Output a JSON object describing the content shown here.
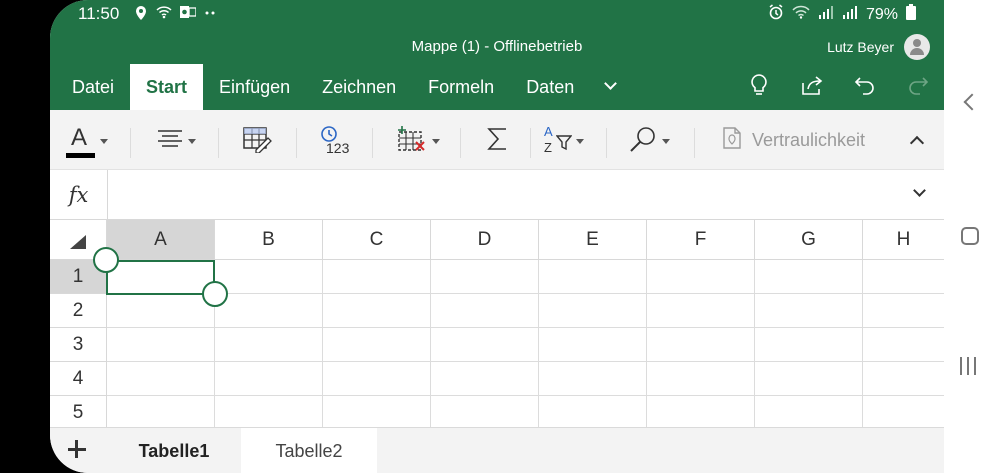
{
  "status": {
    "time": "11:50",
    "battery": "79%",
    "left_icons": [
      "location-icon",
      "wifi-icon",
      "outlook-icon",
      "more-dots-icon"
    ],
    "right_icons": [
      "alarm-icon",
      "wifi-icon",
      "signal-icon",
      "signal-icon",
      "battery-icon"
    ]
  },
  "window": {
    "title": "Mappe (1) - Offlinebetrieb",
    "user": "Lutz Beyer"
  },
  "tabs": [
    {
      "label": "Datei",
      "active": false
    },
    {
      "label": "Start",
      "active": true
    },
    {
      "label": "Einfügen",
      "active": false
    },
    {
      "label": "Zeichnen",
      "active": false
    },
    {
      "label": "Formeln",
      "active": false
    },
    {
      "label": "Daten",
      "active": false
    }
  ],
  "tab_actions": [
    "lightbulb-icon",
    "share-icon",
    "undo-icon",
    "redo-icon"
  ],
  "ribbon": {
    "font_color_letter": "A",
    "number_format_label": "123",
    "sort_label_top": "A",
    "sort_label_bottom": "Z",
    "sensitivity_label": "Vertraulichkeit",
    "font_color_swatch": "#000000"
  },
  "formula_bar": {
    "fx_label": "fx",
    "value": ""
  },
  "grid": {
    "columns": [
      "A",
      "B",
      "C",
      "D",
      "E",
      "F",
      "G",
      "H"
    ],
    "rows": [
      "1",
      "2",
      "3",
      "4",
      "5"
    ],
    "selected_cell": "A1"
  },
  "sheets": [
    {
      "label": "Tabelle1",
      "active": true
    },
    {
      "label": "Tabelle2",
      "active": false
    }
  ],
  "colors": {
    "accent": "#217346",
    "ribbon_bg": "#f3f3f3",
    "header_selected": "#d6d6d6"
  }
}
